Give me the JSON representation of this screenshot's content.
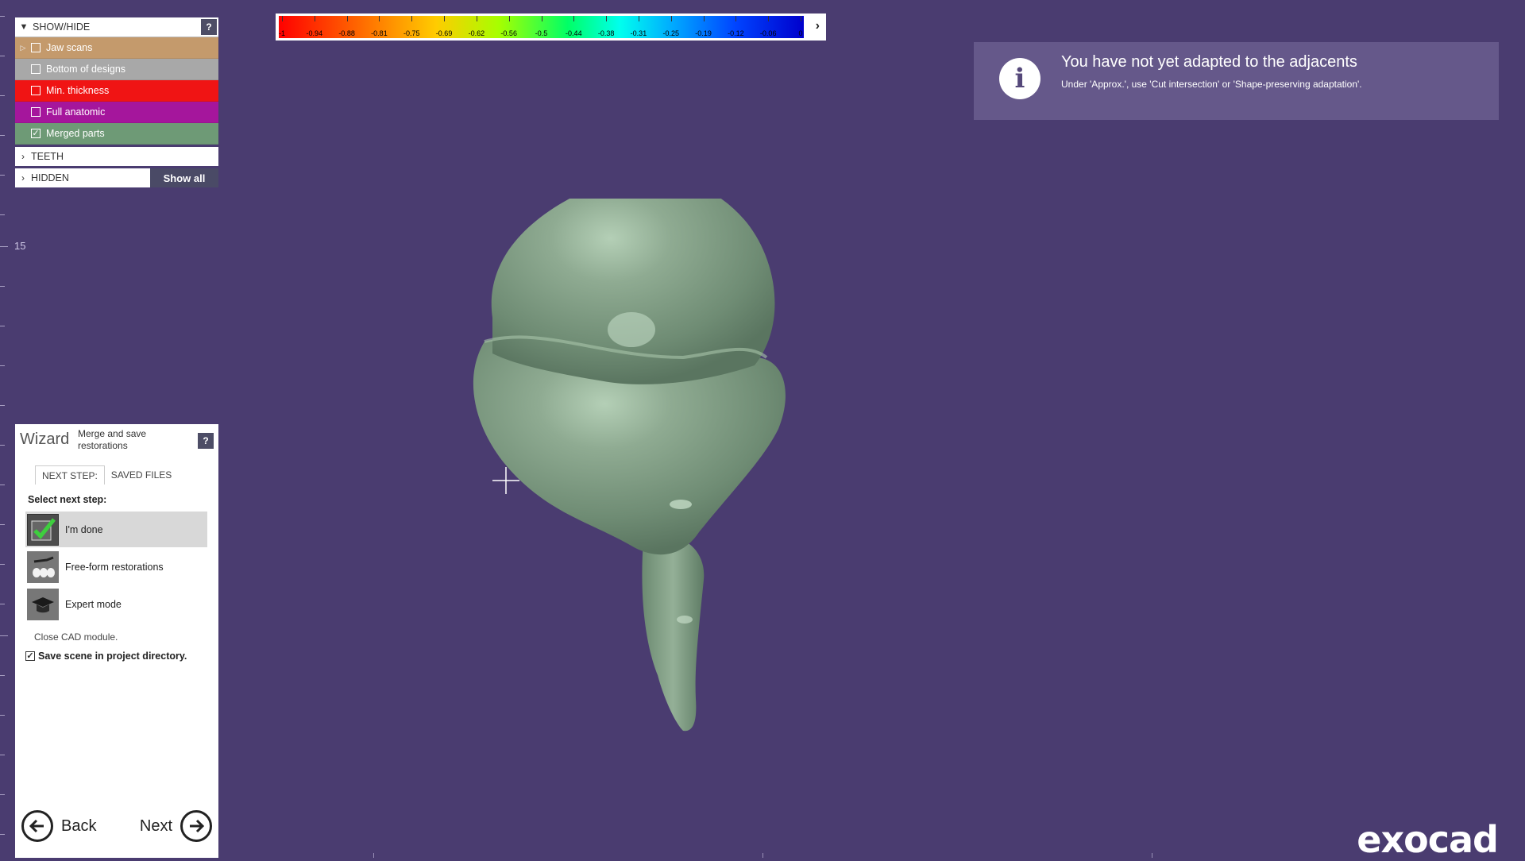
{
  "ruler": {
    "label": "15"
  },
  "show_hide": {
    "title": "SHOW/HIDE",
    "help": "?",
    "items": [
      {
        "label": "Jaw scans",
        "checked": false
      },
      {
        "label": "Bottom of designs",
        "checked": false
      },
      {
        "label": "Min. thickness",
        "checked": false
      },
      {
        "label": "Full anatomic",
        "checked": false
      },
      {
        "label": "Merged parts",
        "checked": true
      }
    ],
    "teeth": "TEETH",
    "hidden": "HIDDEN",
    "show_all": "Show all"
  },
  "color_scale": {
    "labels": [
      "-1",
      "-0.94",
      "-0.88",
      "-0.81",
      "-0.75",
      "-0.69",
      "-0.62",
      "-0.56",
      "-0.5",
      "-0.44",
      "-0.38",
      "-0.31",
      "-0.25",
      "-0.19",
      "-0.12",
      "-0.06",
      "0"
    ],
    "arrow_icon": "chevron-right-icon"
  },
  "info": {
    "icon": "info-icon",
    "title": "You have not yet adapted to the adjacents",
    "message": "Under 'Approx.', use 'Cut intersection' or 'Shape-preserving adaptation'."
  },
  "wizard": {
    "title": "Wizard",
    "subtitle": "Merge and save restorations",
    "help": "?",
    "tabs": [
      "NEXT STEP:",
      "SAVED FILES"
    ],
    "select_label": "Select next step:",
    "steps": [
      {
        "label": "I'm done",
        "icon": "checkmark-icon",
        "selected": true
      },
      {
        "label": "Free-form restorations",
        "icon": "freeform-icon",
        "selected": false
      },
      {
        "label": "Expert mode",
        "icon": "graduation-cap-icon",
        "selected": false
      }
    ],
    "close_cad": "Close CAD module.",
    "save_scene": "Save scene in project directory.",
    "save_checked": true,
    "back": "Back",
    "next": "Next"
  },
  "logo": "exocad",
  "colors": {
    "background": "#4a3c70",
    "model": "#8aa68e",
    "info_bg": "#65588a"
  }
}
